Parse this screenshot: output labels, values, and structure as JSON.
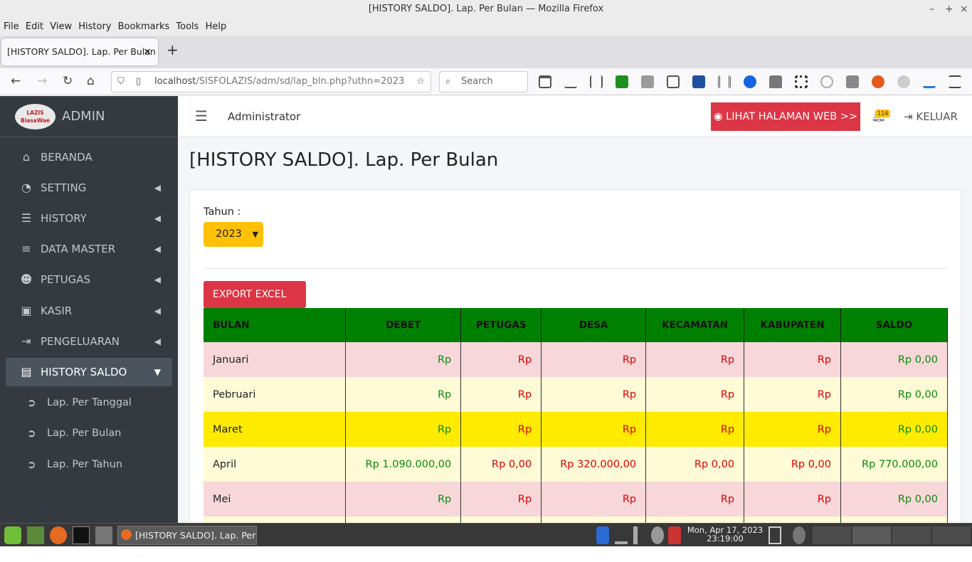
{
  "window": {
    "title": "[HISTORY SALDO]. Lap. Per Bulan — Mozilla Firefox"
  },
  "menu": [
    "File",
    "Edit",
    "View",
    "History",
    "Bookmarks",
    "Tools",
    "Help"
  ],
  "tab": {
    "label": "[HISTORY SALDO]. Lap. Per Bulan",
    "close": "×",
    "new": "+"
  },
  "urlbar": {
    "host": "localhost",
    "path": "/SISFOLAZIS/adm/sd/lap_bln.php?uthn=2023"
  },
  "searchbar": {
    "placeholder": "Search"
  },
  "sidebar": {
    "logo_top": "LAZIS",
    "logo_bottom": "BiasaWae",
    "brand": "ADMIN",
    "items": [
      {
        "label": "BERANDA",
        "icon": "home-icon"
      },
      {
        "label": "SETTING",
        "icon": "tachometer-icon"
      },
      {
        "label": "HISTORY",
        "icon": "list-icon"
      },
      {
        "label": "DATA MASTER",
        "icon": "database-icon"
      },
      {
        "label": "PETUGAS",
        "icon": "users-icon"
      },
      {
        "label": "KASIR",
        "icon": "money-icon"
      },
      {
        "label": "PENGELUARAN",
        "icon": "sign-out-icon"
      },
      {
        "label": "HISTORY SALDO",
        "icon": "briefcase-icon"
      }
    ],
    "subitems": [
      {
        "label": "Lap. Per Tanggal"
      },
      {
        "label": "Lap. Per Bulan"
      },
      {
        "label": "Lap. Per Tahun"
      }
    ]
  },
  "topnav": {
    "user": "Administrator",
    "web_button": "LIHAT HALAMAN WEB >>",
    "notif_count": "114",
    "logout": "KELUAR"
  },
  "page": {
    "title": "[HISTORY SALDO]. Lap. Per Bulan",
    "year_label": "Tahun :",
    "year_value": "2023",
    "export_button": "EXPORT EXCEL >>"
  },
  "table": {
    "headers": [
      "BULAN",
      "DEBET",
      "PETUGAS",
      "DESA",
      "KECAMATAN",
      "KABUPATEN",
      "SALDO"
    ],
    "rows": [
      {
        "bulan": "Januari",
        "debet": "Rp",
        "petugas": "Rp",
        "desa": "Rp",
        "kecamatan": "Rp",
        "kabupaten": "Rp",
        "saldo": "Rp 0,00"
      },
      {
        "bulan": "Pebruari",
        "debet": "Rp",
        "petugas": "Rp",
        "desa": "Rp",
        "kecamatan": "Rp",
        "kabupaten": "Rp",
        "saldo": "Rp 0,00"
      },
      {
        "bulan": "Maret",
        "debet": "Rp",
        "petugas": "Rp",
        "desa": "Rp",
        "kecamatan": "Rp",
        "kabupaten": "Rp",
        "saldo": "Rp 0,00"
      },
      {
        "bulan": "April",
        "debet": "Rp 1.090.000,00",
        "petugas": "Rp 0,00",
        "desa": "Rp 320.000,00",
        "kecamatan": "Rp 0,00",
        "kabupaten": "Rp 0,00",
        "saldo": "Rp 770.000,00"
      },
      {
        "bulan": "Mei",
        "debet": "Rp",
        "petugas": "Rp",
        "desa": "Rp",
        "kecamatan": "Rp",
        "kabupaten": "Rp",
        "saldo": "Rp 0,00"
      },
      {
        "bulan": "",
        "debet": "",
        "petugas": "",
        "desa": "",
        "kecamatan": "",
        "kabupaten": "",
        "saldo": ""
      }
    ]
  },
  "taskbar": {
    "window_label": "[HISTORY SALDO]. Lap. Per ...",
    "date": "Mon, Apr 17, 2023",
    "time": "23:19:00"
  },
  "colors": {
    "sidebar": "#343a40",
    "danger": "#dc3545",
    "warning": "#ffc107",
    "header_green": "#008000",
    "row_pink": "#f8d7da",
    "row_cream": "#fffbd6",
    "row_highlight": "#ffeb00"
  }
}
